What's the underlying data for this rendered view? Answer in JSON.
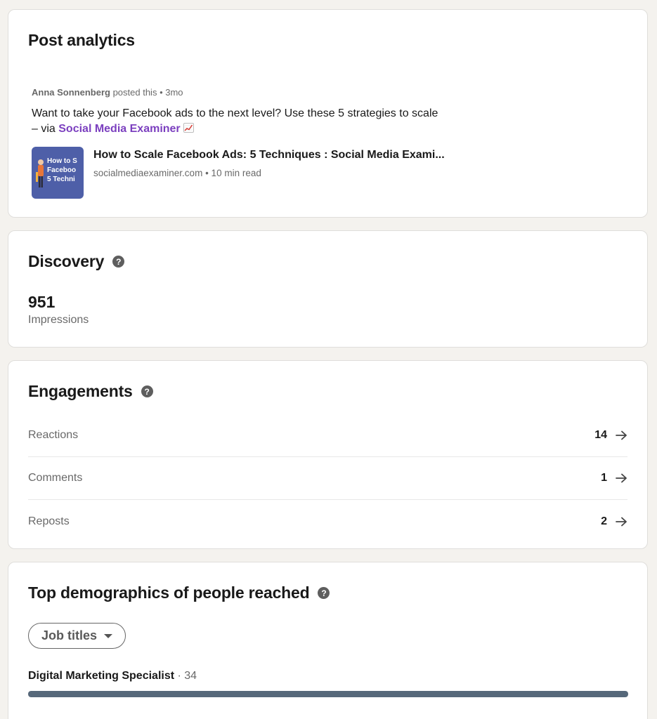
{
  "post": {
    "title": "Post analytics",
    "author": "Anna Sonnenberg",
    "action": " posted this",
    "time": " • 3mo",
    "text_before": "Want to take your Facebook ads to the next level? Use these 5 strategies to scale – via ",
    "mention": "Social Media Examiner",
    "emoji_icon": "chart-increasing-icon",
    "article": {
      "title": "How to Scale Facebook Ads: 5 Techniques : Social Media Exami...",
      "source": "socialmediaexaminer.com",
      "read_time": " • 10 min read",
      "thumb_lines": [
        "How to S",
        "Faceboo",
        "5 Techni"
      ]
    }
  },
  "discovery": {
    "title": "Discovery",
    "impressions": "951",
    "impressions_label": "Impressions"
  },
  "engagements": {
    "title": "Engagements",
    "rows": [
      {
        "label": "Reactions",
        "count": "14"
      },
      {
        "label": "Comments",
        "count": "1"
      },
      {
        "label": "Reposts",
        "count": "2"
      }
    ]
  },
  "demographics": {
    "title": "Top demographics of people reached",
    "dropdown_label": "Job titles",
    "items": [
      {
        "name": "Digital Marketing Specialist",
        "count": " · 34",
        "fraction": 1.0
      }
    ]
  },
  "colors": {
    "background": "#f4f2ee",
    "mention": "#7b3fbf",
    "bar": "#56687a",
    "thumb": "#4e5fa8"
  }
}
